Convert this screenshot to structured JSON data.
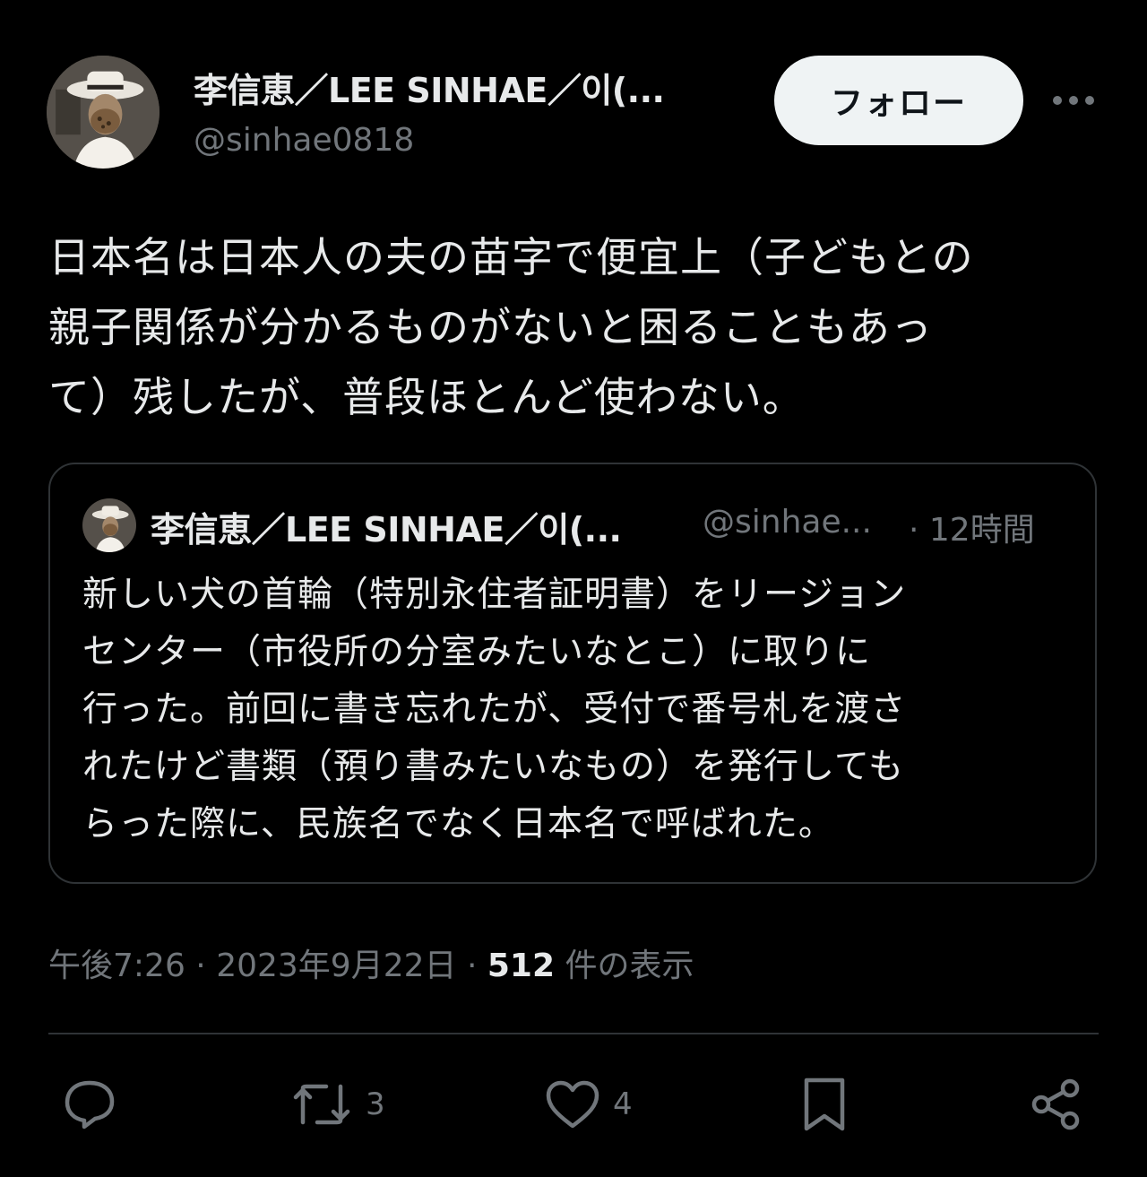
{
  "header": {
    "display_name": "李信恵／LEE SINHAE／이(...",
    "handle": "@sinhae0818",
    "follow_label": "フォロー",
    "more_icon": "more-horizontal-icon"
  },
  "tweet": {
    "text_lines": [
      "日本名は日本人の夫の苗字で便宜上（子どもとの",
      "親子関係が分かるものがないと困ることもあっ",
      "て）残したが、普段ほとんど使わない。"
    ]
  },
  "quote": {
    "display_name": "李信恵／LEE SINHAE／이(...",
    "handle": "@sinhae...",
    "time": "· 12時間",
    "text_lines": [
      "新しい犬の首輪（特別永住者証明書）をリージョン",
      "センター（市役所の分室みたいなとこ）に取りに",
      "行った。前回に書き忘れたが、受付で番号札を渡さ",
      "れたけど書類（預り書みたいなもの）を発行しても",
      "らった際に、民族名でなく日本名で呼ばれた。"
    ]
  },
  "meta": {
    "time": "午後7:26",
    "separator1": " · ",
    "date": "2023年9月22日",
    "separator2": " · ",
    "views_count": "512",
    "views_label": " 件の表示"
  },
  "actions": {
    "reply_icon": "reply-icon",
    "retweet_icon": "retweet-icon",
    "retweet_count": "3",
    "like_icon": "heart-icon",
    "like_count": "4",
    "bookmark_icon": "bookmark-icon",
    "share_icon": "share-icon"
  },
  "colors": {
    "background": "#000000",
    "text_primary": "#e7e9ea",
    "text_secondary": "#71767b",
    "border": "#2f3336",
    "follow_button_bg": "#eff3f4",
    "follow_button_text": "#0f1419"
  }
}
